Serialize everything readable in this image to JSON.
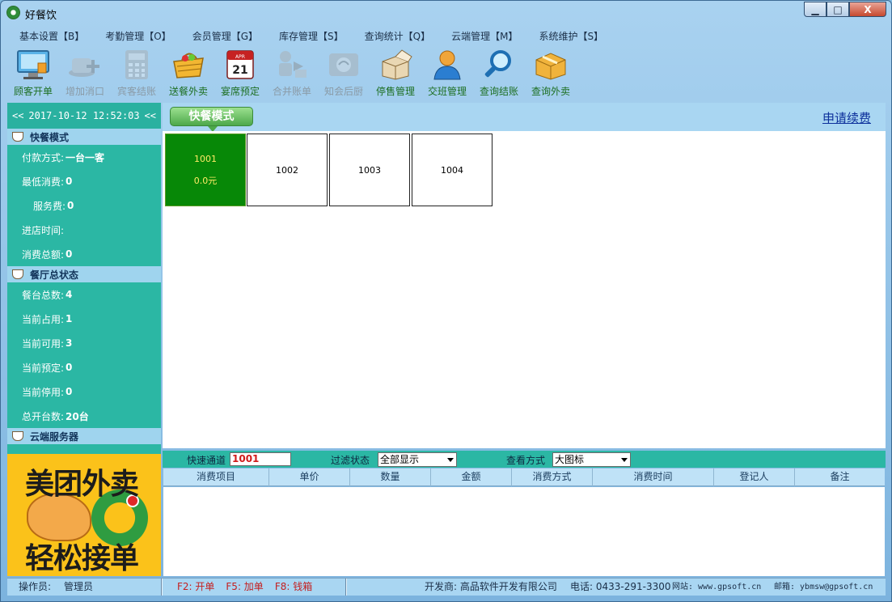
{
  "window": {
    "title": "好餐饮",
    "min_glyph": "▁",
    "max_glyph": "□",
    "close_glyph": "X"
  },
  "menu": [
    "基本设置【B】",
    "考勤管理【O】",
    "会员管理【G】",
    "库存管理【S】",
    "查询统计【Q】",
    "云端管理【M】",
    "系统维护【S】"
  ],
  "toolbar": [
    {
      "label": "顾客开单",
      "icon": "monitor-icon",
      "enabled": true
    },
    {
      "label": "增加消口",
      "icon": "add-coffee-icon",
      "enabled": false
    },
    {
      "label": "宾客结账",
      "icon": "calculator-icon",
      "enabled": false
    },
    {
      "label": "送餐外卖",
      "icon": "basket-icon",
      "enabled": true
    },
    {
      "label": "宴席预定",
      "icon": "calendar-icon",
      "enabled": true
    },
    {
      "label": "合并账单",
      "icon": "merge-icon",
      "enabled": false
    },
    {
      "label": "知会后厨",
      "icon": "kitchen-icon",
      "enabled": false
    },
    {
      "label": "停售管理",
      "icon": "box-icon",
      "enabled": true
    },
    {
      "label": "交班管理",
      "icon": "user-icon",
      "enabled": true
    },
    {
      "label": "查询结账",
      "icon": "magnifier-icon",
      "enabled": true
    },
    {
      "label": "查询外卖",
      "icon": "package-icon",
      "enabled": true
    }
  ],
  "calendar_icon": {
    "month": "APR",
    "day": "21"
  },
  "clock": {
    "prev": "<<",
    "datetime": "2017-10-12 12:52:03",
    "next": "<<"
  },
  "panels": {
    "fast_food": {
      "title": "快餐模式",
      "rows": [
        {
          "key": "付款方式:",
          "value": "一台一客"
        },
        {
          "key": "最低消费:",
          "value": "0"
        },
        {
          "key": "服务费:",
          "value": "0"
        },
        {
          "key": "进店时间:",
          "value": ""
        },
        {
          "key": "消费总额:",
          "value": "0"
        }
      ]
    },
    "hall_status": {
      "title": "餐厅总状态",
      "rows": [
        {
          "key": "餐台总数:",
          "value": "4"
        },
        {
          "key": "当前占用:",
          "value": "1"
        },
        {
          "key": "当前可用:",
          "value": "3"
        },
        {
          "key": "当前预定:",
          "value": "0"
        },
        {
          "key": "当前停用:",
          "value": "0"
        },
        {
          "key": "总开台数:",
          "value": "20台"
        }
      ]
    },
    "cloud": {
      "title": "云端服务器"
    }
  },
  "ad": {
    "line1": "美团外卖",
    "line2": "轻松接单"
  },
  "main": {
    "mode_tab": "快餐模式",
    "renew_link": "申请续费",
    "tables": [
      {
        "name": "1001",
        "amount": "0.0元",
        "occupied": true
      },
      {
        "name": "1002",
        "amount": "",
        "occupied": false
      },
      {
        "name": "1003",
        "amount": "",
        "occupied": false
      },
      {
        "name": "1004",
        "amount": "",
        "occupied": false
      }
    ]
  },
  "filter": {
    "quick_label": "快速通道",
    "quick_value": "1001",
    "status_label": "过滤状态",
    "status_value": "全部显示",
    "view_label": "查看方式",
    "view_value": "大图标"
  },
  "grid": {
    "columns": [
      "消费项目",
      "单价",
      "数量",
      "金额",
      "消费方式",
      "消费时间",
      "登记人",
      "备注"
    ]
  },
  "status": {
    "operator_label": "操作员:",
    "operator": "管理员",
    "keys": [
      "F2: 开单",
      "F5: 加单",
      "F8: 钱箱"
    ],
    "developer": "开发商: 高品软件开发有限公司",
    "phone": "电话: 0433-291-3300",
    "website": "网站: www.gpsoft.cn",
    "email": "邮箱: ybmsw@gpsoft.cn"
  },
  "colors": {
    "panel_teal": "#2bb7a4",
    "header_blue": "#a9d6f2",
    "occupied_green": "#078807",
    "tool_label_green": "#1d6f22",
    "hotkey_red": "#c42020"
  }
}
